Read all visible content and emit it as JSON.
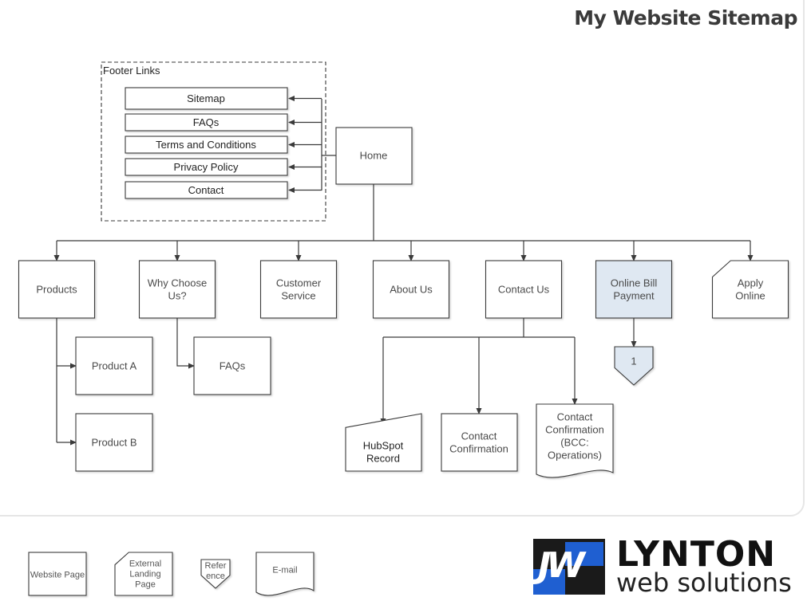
{
  "header": {
    "title": "My Website Sitemap"
  },
  "footer_group": {
    "label": "Footer Links",
    "items": [
      "Sitemap",
      "FAQs",
      "Terms and Conditions",
      "Privacy Policy",
      "Contact"
    ]
  },
  "home": {
    "label": "Home"
  },
  "top_level": [
    {
      "label_lines": [
        "Products"
      ],
      "type": "page"
    },
    {
      "label_lines": [
        "Why Choose",
        "Us?"
      ],
      "type": "page"
    },
    {
      "label_lines": [
        "Customer",
        "Service"
      ],
      "type": "page"
    },
    {
      "label_lines": [
        "About Us"
      ],
      "type": "page"
    },
    {
      "label_lines": [
        "Contact Us"
      ],
      "type": "page"
    },
    {
      "label_lines": [
        "Online Bill",
        "Payment"
      ],
      "type": "page-highlighted"
    },
    {
      "label_lines": [
        "Apply",
        "Online"
      ],
      "type": "external"
    }
  ],
  "products_children": [
    "Product A",
    "Product B"
  ],
  "why_children": [
    "FAQs"
  ],
  "contact_children": [
    {
      "label_lines": [
        "HubSpot",
        "Record"
      ],
      "type": "manual-input"
    },
    {
      "label_lines": [
        "Contact",
        "Confirmation"
      ],
      "type": "page"
    },
    {
      "label_lines": [
        "Contact",
        "Confirmation",
        "(BCC:",
        "Operations)"
      ],
      "type": "email"
    }
  ],
  "billing_reference": {
    "label": "1"
  },
  "legend": [
    {
      "label_lines": [
        "Website Page"
      ],
      "type": "page"
    },
    {
      "label_lines": [
        "External",
        "Landing",
        "Page"
      ],
      "type": "external"
    },
    {
      "label_lines": [
        "Refer",
        "ence"
      ],
      "type": "reference"
    },
    {
      "label_lines": [
        "E-mail"
      ],
      "type": "email"
    }
  ],
  "logo": {
    "mark": "JW",
    "name": "LYNTON",
    "tagline": "web solutions"
  },
  "colors": {
    "line": "#3a3a3a",
    "highlight_fill": "#dfe8f2",
    "text": "#4a4a4a"
  }
}
